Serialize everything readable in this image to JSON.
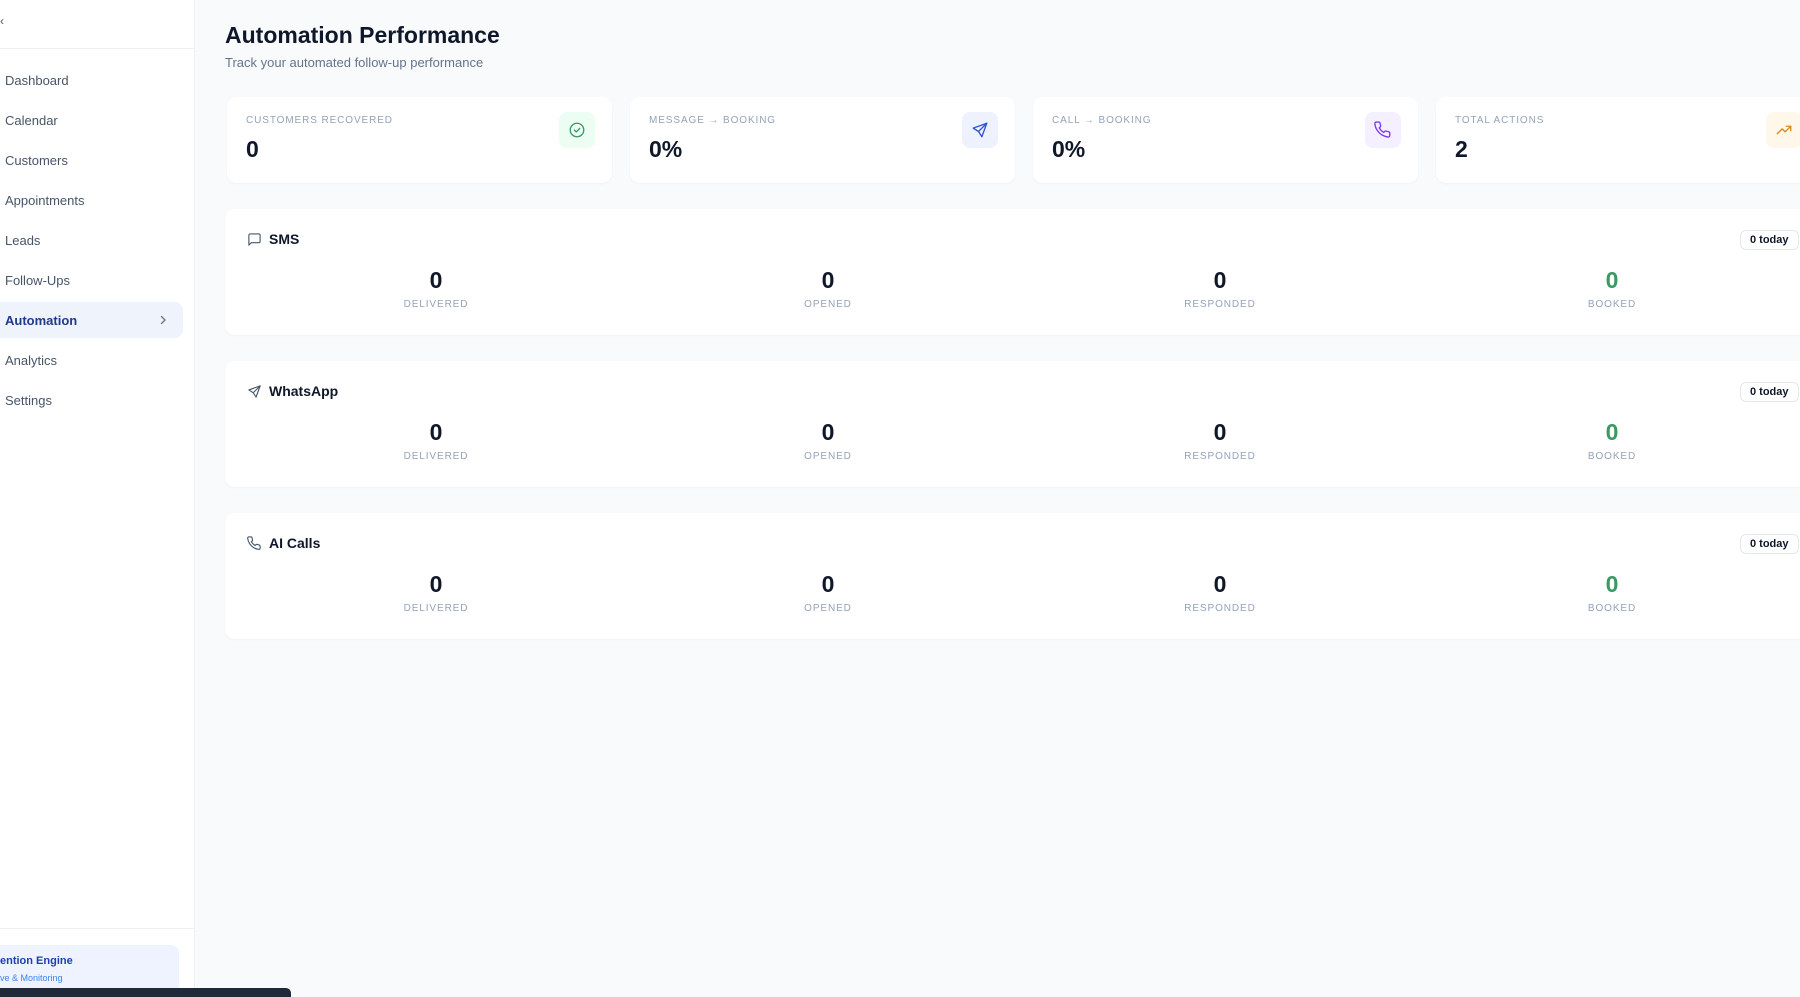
{
  "sidebar": {
    "brand_glyph": "‹",
    "items": [
      {
        "label": "Dashboard"
      },
      {
        "label": "Calendar"
      },
      {
        "label": "Customers"
      },
      {
        "label": "Appointments"
      },
      {
        "label": "Leads"
      },
      {
        "label": "Follow-Ups"
      },
      {
        "label": "Automation",
        "active": true
      },
      {
        "label": "Analytics"
      },
      {
        "label": "Settings"
      }
    ],
    "engine": {
      "title": "ention Engine",
      "subtitle": "ve & Monitoring"
    }
  },
  "header": {
    "title": "Automation Performance",
    "subtitle": "Track your automated follow-up performance"
  },
  "stats": [
    {
      "label": "CUSTOMERS RECOVERED",
      "value": "0",
      "icon": "check-circle-icon",
      "icon_bg": "#ecfdf3",
      "icon_color": "#3b9a62"
    },
    {
      "label": "MESSAGE → BOOKING",
      "value": "0%",
      "icon": "send-icon",
      "icon_bg": "#eef2ff",
      "icon_color": "#2f55d4"
    },
    {
      "label": "CALL → BOOKING",
      "value": "0%",
      "icon": "phone-icon",
      "icon_bg": "#f5f0ff",
      "icon_color": "#7c3aed"
    },
    {
      "label": "TOTAL ACTIONS",
      "value": "2",
      "icon": "trending-up-icon",
      "icon_bg": "#fff7ea",
      "icon_color": "#d98a1c"
    }
  ],
  "channels": [
    {
      "name": "SMS",
      "icon": "message-square-icon",
      "badge": "0 today",
      "metrics": [
        {
          "label": "DELIVERED",
          "value": "0"
        },
        {
          "label": "OPENED",
          "value": "0"
        },
        {
          "label": "RESPONDED",
          "value": "0"
        },
        {
          "label": "BOOKED",
          "value": "0"
        }
      ]
    },
    {
      "name": "WhatsApp",
      "icon": "send-icon",
      "badge": "0 today",
      "metrics": [
        {
          "label": "DELIVERED",
          "value": "0"
        },
        {
          "label": "OPENED",
          "value": "0"
        },
        {
          "label": "RESPONDED",
          "value": "0"
        },
        {
          "label": "BOOKED",
          "value": "0"
        }
      ]
    },
    {
      "name": "AI Calls",
      "icon": "phone-icon",
      "badge": "0 today",
      "metrics": [
        {
          "label": "DELIVERED",
          "value": "0"
        },
        {
          "label": "OPENED",
          "value": "0"
        },
        {
          "label": "RESPONDED",
          "value": "0"
        },
        {
          "label": "BOOKED",
          "value": "0"
        }
      ]
    }
  ],
  "colors": {
    "accent": "#1e3a8a",
    "booked": "#3b9a62"
  }
}
